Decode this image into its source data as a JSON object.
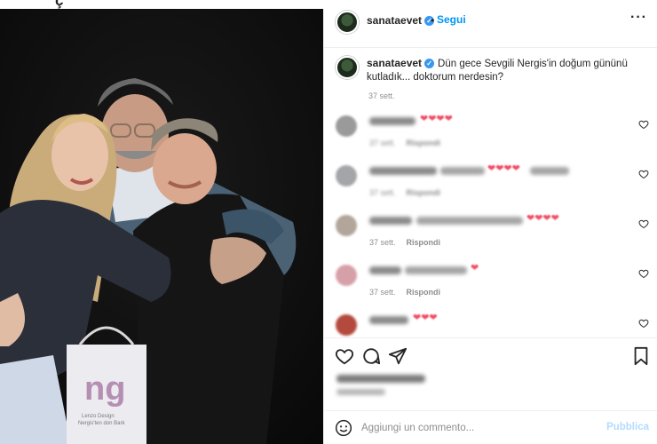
{
  "top_clip": {
    "text": "ç"
  },
  "photo": {
    "bag_logo": "ng",
    "bag_caption_1": "Lenzo Design",
    "bag_caption_2": "Nergis'ten don Bark"
  },
  "post": {
    "username": "sanataevet",
    "verified": true,
    "follow_label": "Segui",
    "more_icon": "more-horizontal-icon",
    "caption": {
      "username": "sanataevet",
      "text": "Dün gece Sevgili Nergis'in doğum gününü kutladık... doktorum nerdesin?",
      "time": "37 sett."
    }
  },
  "comments": [
    {
      "avatar_color": "#9a9a9a",
      "emoji": "❤❤❤❤",
      "time": "37 sett.",
      "reply": "Rispondi",
      "blurred_meta": true
    },
    {
      "avatar_color": "#a3a5a8",
      "emoji": "❤❤❤❤",
      "time": "37 sett.",
      "reply": "Rispondi",
      "blurred_meta": true
    },
    {
      "avatar_color": "#b2a59a",
      "emoji": "❤❤❤❤",
      "time": "37 sett.",
      "reply": "Rispondi",
      "blurred_meta": false
    },
    {
      "avatar_color": "#d6a0a8",
      "emoji": "❤",
      "time": "37 sett.",
      "reply": "Rispondi",
      "blurred_meta": false
    },
    {
      "avatar_color": "#b44a3e",
      "emoji": "❤❤❤",
      "time": "",
      "reply": "",
      "blurred_meta": false
    }
  ],
  "actions": {
    "like_icon": "heart-icon",
    "comment_icon": "comment-icon",
    "share_icon": "share-icon",
    "save_icon": "bookmark-icon"
  },
  "add_comment": {
    "emoji_icon": "smile-icon",
    "placeholder": "Aggiungi un commento...",
    "publish_label": "Pubblica"
  },
  "colors": {
    "link_blue": "#0095f6",
    "publish_disabled": "#b3dbff",
    "heart_red": "#ef4b63"
  }
}
